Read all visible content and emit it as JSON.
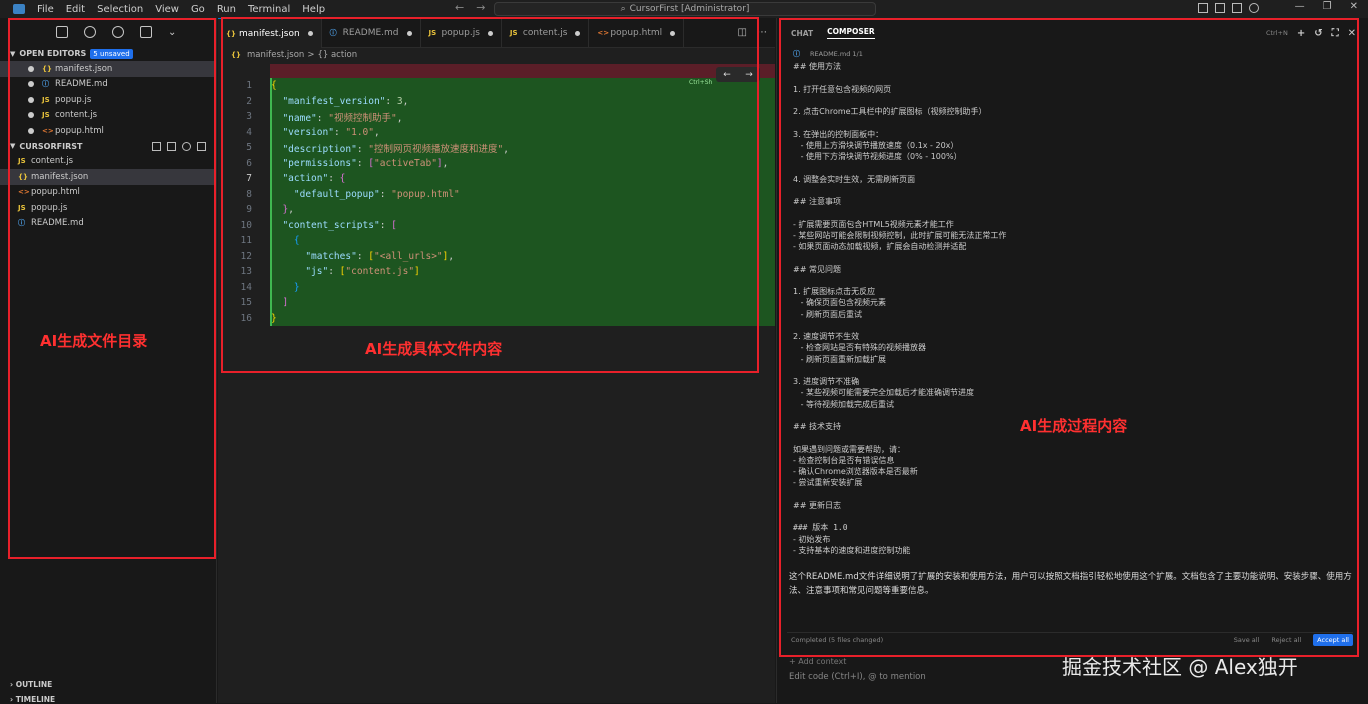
{
  "titlebar": {
    "menu": [
      "File",
      "Edit",
      "Selection",
      "View",
      "Go",
      "Run",
      "Terminal",
      "Help"
    ],
    "search_text": "CursorFirst [Administrator]"
  },
  "sidebar": {
    "open_editors_label": "OPEN EDITORS",
    "unsaved_badge": "5 unsaved",
    "open_editors": [
      {
        "icon": "{}",
        "type": "json",
        "name": "manifest.json"
      },
      {
        "icon": "ⓘ",
        "type": "md",
        "name": "README.md"
      },
      {
        "icon": "JS",
        "type": "js",
        "name": "popup.js"
      },
      {
        "icon": "JS",
        "type": "js",
        "name": "content.js"
      },
      {
        "icon": "<>",
        "type": "html",
        "name": "popup.html"
      }
    ],
    "project_label": "CURSORFIRST",
    "project_files": [
      {
        "icon": "JS",
        "type": "js",
        "name": "content.js"
      },
      {
        "icon": "{}",
        "type": "json",
        "name": "manifest.json"
      },
      {
        "icon": "<>",
        "type": "html",
        "name": "popup.html"
      },
      {
        "icon": "JS",
        "type": "js",
        "name": "popup.js"
      },
      {
        "icon": "ⓘ",
        "type": "md",
        "name": "README.md"
      }
    ],
    "outline_label": "OUTLINE",
    "timeline_label": "TIMELINE"
  },
  "editor": {
    "tabs": [
      {
        "icon": "{}",
        "type": "json",
        "name": "manifest.json"
      },
      {
        "icon": "ⓘ",
        "type": "md",
        "name": "README.md"
      },
      {
        "icon": "JS",
        "type": "js",
        "name": "popup.js"
      },
      {
        "icon": "JS",
        "type": "js",
        "name": "content.js"
      },
      {
        "icon": "<>",
        "type": "html",
        "name": "popup.html"
      }
    ],
    "breadcrumb": [
      "manifest.json",
      ">",
      "{} action"
    ],
    "diff_hint": "Ctrl+Sh",
    "line_numbers": [
      "1",
      "2",
      "3",
      "4",
      "5",
      "6",
      "7",
      "8",
      "9",
      "10",
      "11",
      "12",
      "13",
      "14",
      "15",
      "16"
    ],
    "current_line": "7"
  },
  "chat": {
    "tab_chat": "CHAT",
    "tab_composer": "COMPOSER",
    "shortcut": "Ctrl+N",
    "file_chip": "README.md 1/1",
    "readme_lines": [
      "## 使用方法",
      "",
      "1. 打开任意包含视频的网页",
      "",
      "2. 点击Chrome工具栏中的扩展图标（视频控制助手）",
      "",
      "3. 在弹出的控制面板中：",
      "   - 使用上方滑块调节播放速度（0.1x - 20x）",
      "   - 使用下方滑块调节视频进度（0% - 100%）",
      "",
      "4. 调整会实时生效，无需刷新页面",
      "",
      "## 注意事项",
      "",
      "- 扩展需要页面包含HTML5视频元素才能工作",
      "- 某些网站可能会限制视频控制，此时扩展可能无法正常工作",
      "- 如果页面动态加载视频，扩展会自动检测并适配",
      "",
      "## 常见问题",
      "",
      "1. 扩展图标点击无反应",
      "   - 确保页面包含视频元素",
      "   - 刷新页面后重试",
      "",
      "2. 速度调节不生效",
      "   - 检查网站是否有特殊的视频播放器",
      "   - 刷新页面重新加载扩展",
      "",
      "3. 进度调节不准确",
      "   - 某些视频可能需要完全加载后才能准确调节进度",
      "   - 等待视频加载完成后重试",
      "",
      "## 技术支持",
      "",
      "如果遇到问题或需要帮助，请：",
      "- 检查控制台是否有错误信息",
      "- 确认Chrome浏览器版本是否最新",
      "- 尝试重新安装扩展",
      "",
      "## 更新日志",
      "",
      "### 版本 1.0",
      "- 初始发布",
      "- 支持基本的速度和进度控制功能"
    ],
    "summary": "这个README.md文件详细说明了扩展的安装和使用方法，用户可以按照文档指引轻松地使用这个扩展。文档包含了主要功能说明、安装步骤、使用方法、注意事项和常见问题等重要信息。",
    "completed": "Completed (5 files changed)",
    "save_all": "Save all",
    "reject_all": "Reject all",
    "accept_all": "Accept all",
    "add_context": "+ Add context",
    "edit_placeholder": "Edit code (Ctrl+I), @ to mention"
  },
  "annotations": {
    "sidebar_label": "AI生成文件目录",
    "editor_label": "AI生成具体文件内容",
    "chat_label": "AI生成过程内容",
    "color": "#e8202a"
  },
  "watermark": "掘金技术社区 @ Alex独开"
}
